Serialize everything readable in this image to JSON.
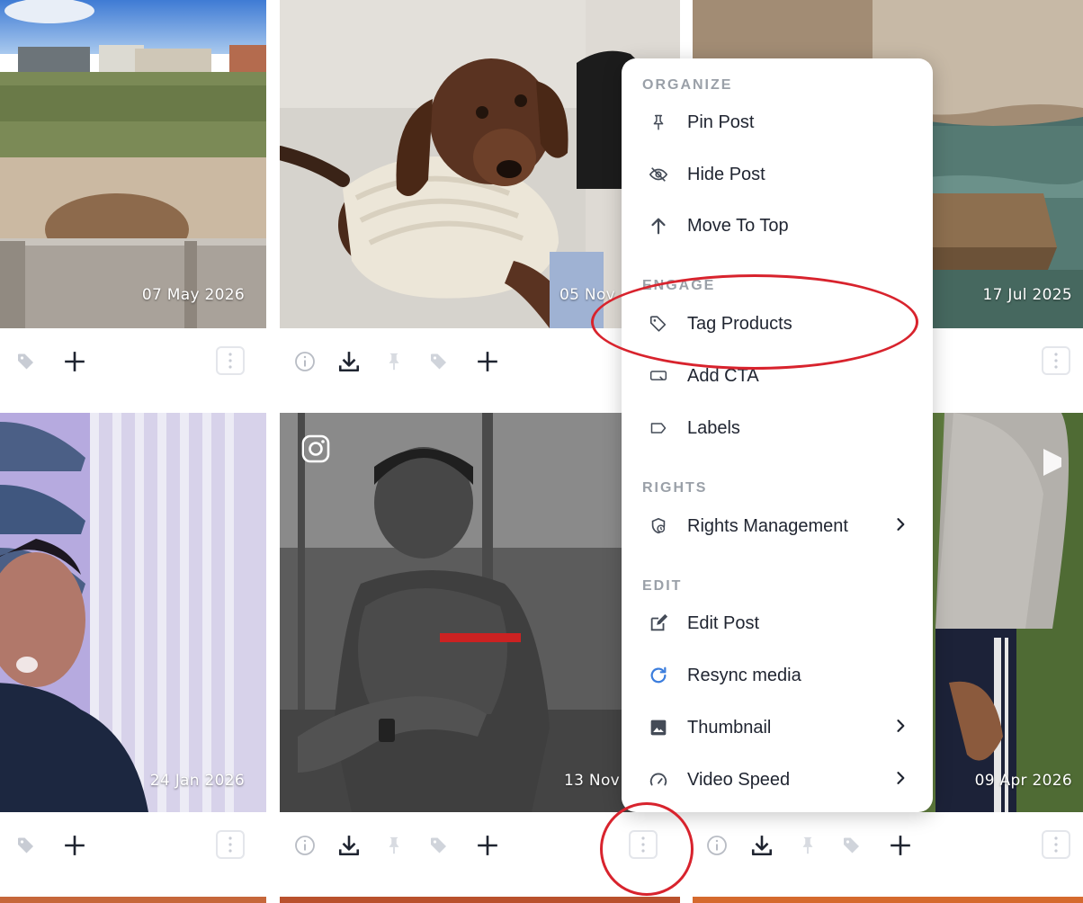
{
  "posts": [
    {
      "date": "07 May 2026"
    },
    {
      "date": "05 Nov"
    },
    {
      "date": "17 Jul 2025"
    },
    {
      "date": "24 Jan 2026"
    },
    {
      "date": "13 Nov 2"
    },
    {
      "date": "09 Apr 2026"
    }
  ],
  "menu": {
    "sections": [
      {
        "title": "ORGANIZE",
        "items": [
          {
            "label": "Pin Post",
            "icon": "pin-icon"
          },
          {
            "label": "Hide Post",
            "icon": "eye-off-icon"
          },
          {
            "label": "Move To Top",
            "icon": "arrow-up-icon"
          }
        ]
      },
      {
        "title": "ENGAGE",
        "items": [
          {
            "label": "Tag Products",
            "icon": "tag-icon"
          },
          {
            "label": "Add CTA",
            "icon": "cta-icon"
          },
          {
            "label": "Labels",
            "icon": "label-icon"
          }
        ]
      },
      {
        "title": "RIGHTS",
        "items": [
          {
            "label": "Rights Management",
            "icon": "rights-icon",
            "submenu": true
          }
        ]
      },
      {
        "title": "EDIT",
        "items": [
          {
            "label": "Edit Post",
            "icon": "edit-icon"
          },
          {
            "label": "Resync media",
            "icon": "refresh-icon"
          },
          {
            "label": "Thumbnail",
            "icon": "image-icon",
            "submenu": true
          },
          {
            "label": "Video Speed",
            "icon": "speedometer-icon",
            "submenu": true
          }
        ]
      }
    ]
  },
  "colors": {
    "highlight_ring": "#d8232d",
    "resync_icon": "#3b7ddd",
    "muted_icon": "#c8ccd4"
  }
}
